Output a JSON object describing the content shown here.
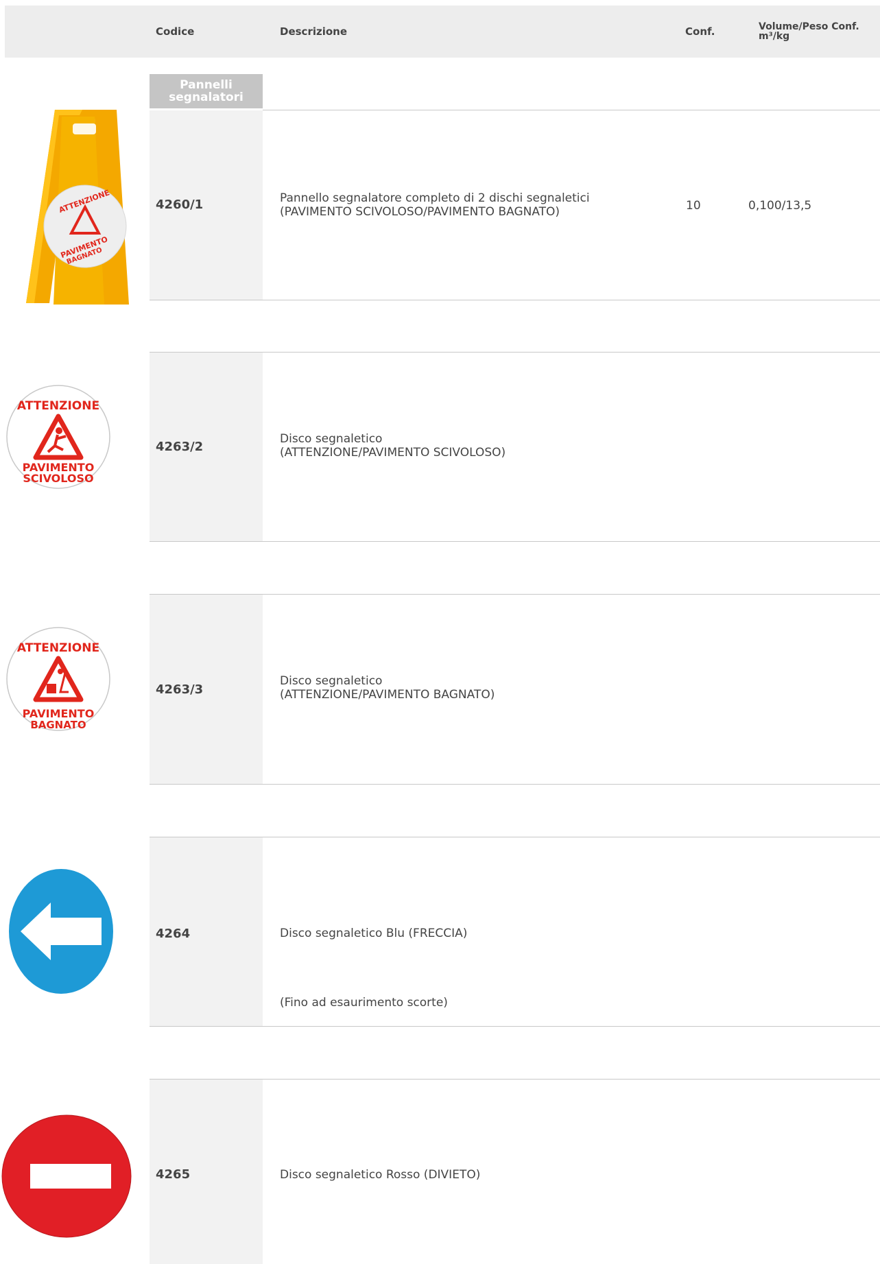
{
  "header": {
    "codice": "Codice",
    "descrizione": "Descrizione",
    "conf": "Conf.",
    "volume_line1": "Volume/Peso Conf.",
    "volume_line2": "m³/kg"
  },
  "category": "Pannelli segnalatori",
  "sign_texts": {
    "attenzione": "ATTENZIONE",
    "pavimento": "PAVIMENTO",
    "scivoloso": "SCIVOLOSO",
    "bagnato": "BAGNATO"
  },
  "products": [
    {
      "code": "4260/1",
      "desc_line1": "Pannello segnalatore completo di 2 dischi segnaletici",
      "desc_line2": "(PAVIMENTO SCIVOLOSO/PAVIMENTO BAGNATO)",
      "conf": "10",
      "volume": "0,100/13,5",
      "image": "yellow-floor-sign"
    },
    {
      "code": "4263/2",
      "desc_line1": "Disco segnaletico",
      "desc_line2": "(ATTENZIONE/PAVIMENTO SCIVOLOSO)",
      "image": "slippery-floor-disc"
    },
    {
      "code": "4263/3",
      "desc_line1": "Disco segnaletico",
      "desc_line2": "(ATTENZIONE/PAVIMENTO BAGNATO)",
      "image": "wet-floor-disc"
    },
    {
      "code": "4264",
      "desc_line1": "Disco segnaletico Blu (FRECCIA)",
      "note": "(Fino ad esaurimento scorte)",
      "image": "blue-arrow-disc"
    },
    {
      "code": "4265",
      "desc_line1": "Disco segnaletico Rosso (DIVIETO)",
      "image": "red-no-entry-disc"
    }
  ],
  "colors": {
    "header_bg": "#ededed",
    "code_column_bg": "#f2f2f2",
    "category_bg": "#c5c5c5",
    "sign_red": "#e1261c",
    "sign_yellow": "#f7b500",
    "arrow_blue": "#1e9ad6",
    "divieto_red": "#e11f26"
  }
}
